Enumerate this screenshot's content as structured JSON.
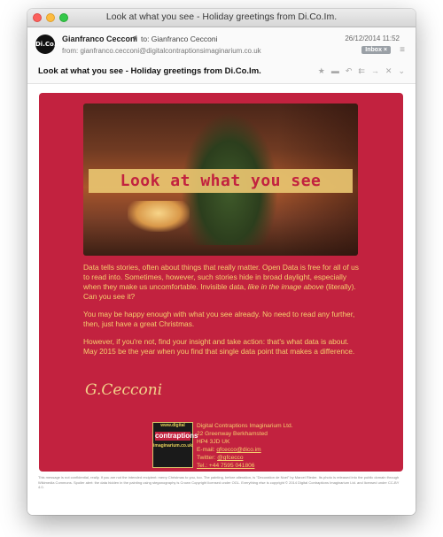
{
  "window": {
    "title": "Look at what you see - Holiday greetings from Di.Co.Im."
  },
  "header": {
    "avatar_text": "Di.Co.Im.",
    "sender": "Gianfranco Cecconi",
    "to": "to: Gianfranco Cecconi",
    "from": "from: gianfranco.cecconi@digitalcontraptionsimaginarium.co.uk",
    "date": "26/12/2014 11:52",
    "badge": "Inbox ×",
    "subject": "Look at what you see - Holiday greetings from Di.Co.Im.",
    "actions": [
      "star-icon",
      "comment-icon",
      "reply-icon",
      "reply-all-icon",
      "forward-icon",
      "delete-icon",
      "more-icon"
    ]
  },
  "email": {
    "banner": "Look at what you see",
    "para1_a": "Data tells stories, often about things that really matter. Open Data is free for all of us to read into. Sometimes, however, such stories hide in broad daylight, especially when they make us uncomfortable. Invisible data, ",
    "para1_em": "like in the image above",
    "para1_b": " (literally). Can you see it?",
    "para2": "You may be happy enough with what you see already. No need to read any further, then, just have a great Christmas.",
    "para3": "However, if you're not, find your insight and take action: that's what data is about. May 2015 be the year when you find that single data point that makes a difference.",
    "signature": "G.Cecconi",
    "logo_top": "www.digital",
    "logo_mid": "contraptions",
    "logo_bot": "imaginarium.co.uk",
    "contact": {
      "company": "Digital Contraptions Imaginarium Ltd.",
      "address1": "22 Greenway   Berkhamsted",
      "address2": "HP4 3JD   UK",
      "email_label": "E-mail: ",
      "email": "gfcecco@dico.im",
      "twitter_label": "Twitter: ",
      "twitter": "@gfcecco",
      "tel": "Tel.: +44 7595 041806"
    },
    "footnote": "This message is not confidential, really. If you are not the intended recipient: merry Christmas to you, too. The painting, before alteration, is \"Decoration de Noel\" by Marcel Rieder. Its photo is released into the public domain through Wikimedia Commons. Spoiler alert: the data hidden in the painting using steganography is Crown Copyright licensed under OGL. Everything else is copyright © 2014 Digital Contraptions Imaginarium Ltd. and licensed under CC-BY 4.0."
  }
}
